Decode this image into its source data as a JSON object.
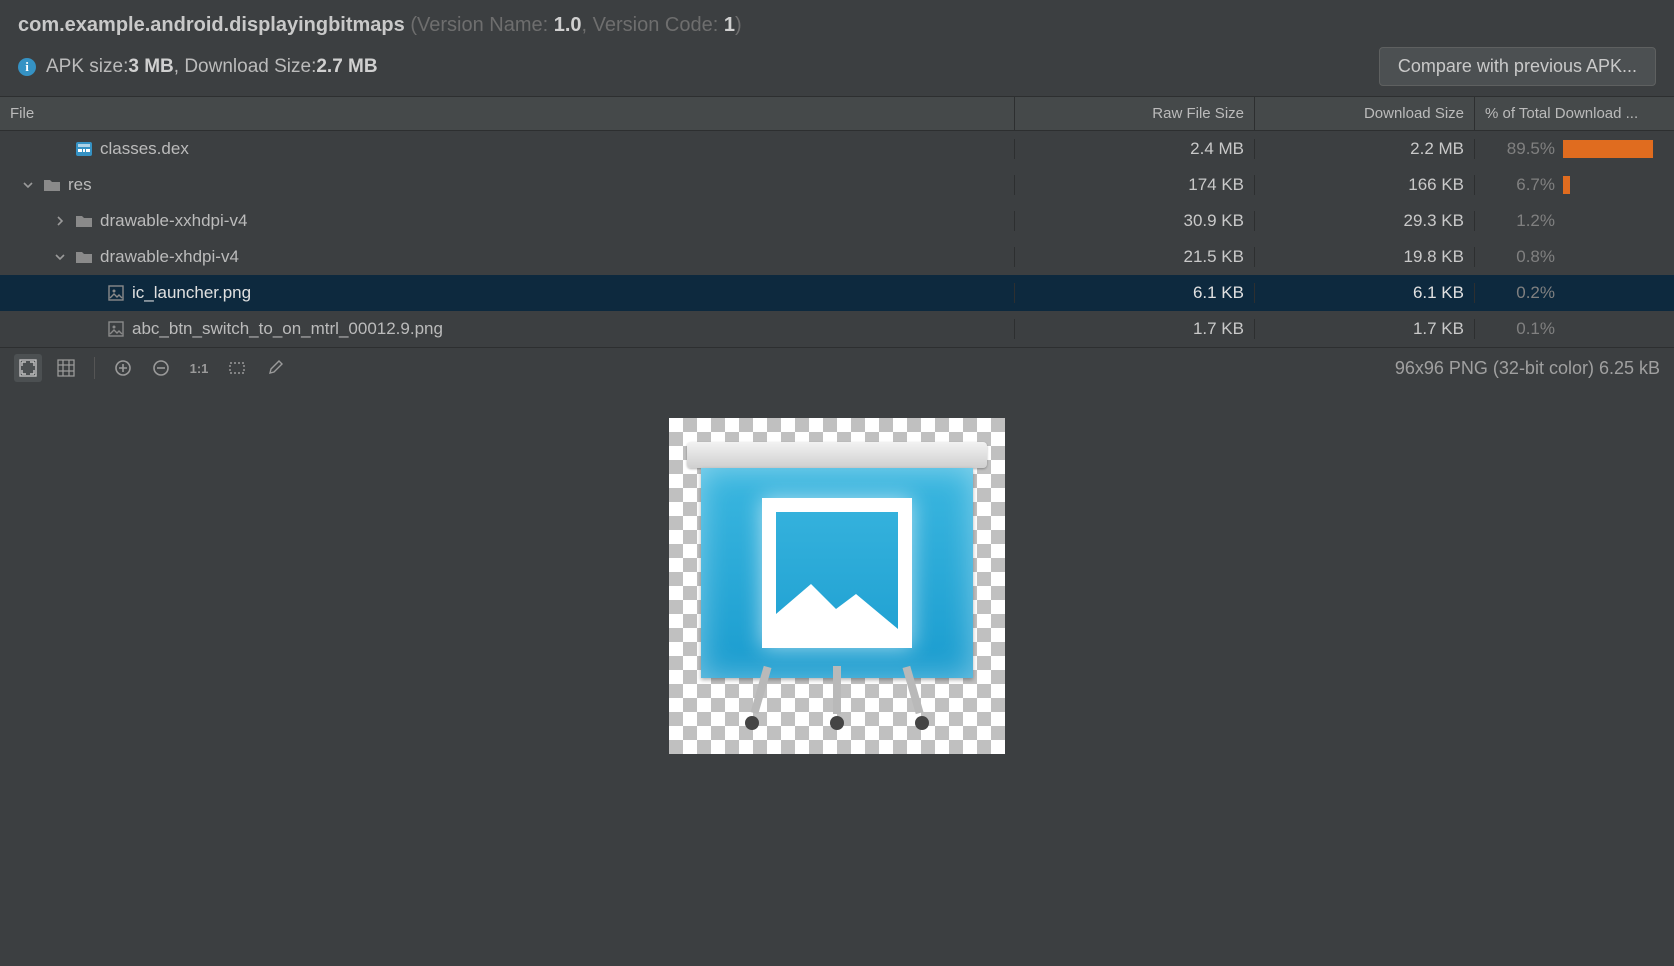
{
  "header": {
    "package": "com.example.android.displayingbitmaps",
    "version_name_label": "(Version Name: ",
    "version_name": "1.0",
    "version_code_label": ", Version Code: ",
    "version_code": "1",
    "close_paren": ")",
    "apk_size_label": "APK size: ",
    "apk_size": "3 MB",
    "dl_size_label": ", Download Size: ",
    "dl_size": "2.7 MB",
    "compare_btn": "Compare with previous APK..."
  },
  "columns": {
    "file": "File",
    "raw": "Raw File Size",
    "dl": "Download Size",
    "pct": "% of Total Download ..."
  },
  "rows": [
    {
      "indent": 1,
      "chev": "",
      "icon": "dex",
      "name": "classes.dex",
      "raw": "2.4 MB",
      "dl": "2.2 MB",
      "pct": "89.5%",
      "bar": 89.5,
      "sel": false
    },
    {
      "indent": 0,
      "chev": "v",
      "icon": "folder",
      "name": "res",
      "raw": "174 KB",
      "dl": "166 KB",
      "pct": "6.7%",
      "bar": 6.7,
      "sel": false
    },
    {
      "indent": 1,
      "chev": ">",
      "icon": "folder",
      "name": "drawable-xxhdpi-v4",
      "raw": "30.9 KB",
      "dl": "29.3 KB",
      "pct": "1.2%",
      "bar": 0,
      "sel": false
    },
    {
      "indent": 1,
      "chev": "v",
      "icon": "folder",
      "name": "drawable-xhdpi-v4",
      "raw": "21.5 KB",
      "dl": "19.8 KB",
      "pct": "0.8%",
      "bar": 0,
      "sel": false
    },
    {
      "indent": 2,
      "chev": "",
      "icon": "img",
      "name": "ic_launcher.png",
      "raw": "6.1 KB",
      "dl": "6.1 KB",
      "pct": "0.2%",
      "bar": 0,
      "sel": true
    },
    {
      "indent": 2,
      "chev": "",
      "icon": "img",
      "name": "abc_btn_switch_to_on_mtrl_00012.9.png",
      "raw": "1.7 KB",
      "dl": "1.7 KB",
      "pct": "0.1%",
      "bar": 0,
      "sel": false
    }
  ],
  "toolbar": {
    "preview_info": "96x96 PNG (32-bit color) 6.25 kB",
    "btn_11": "1:1"
  }
}
